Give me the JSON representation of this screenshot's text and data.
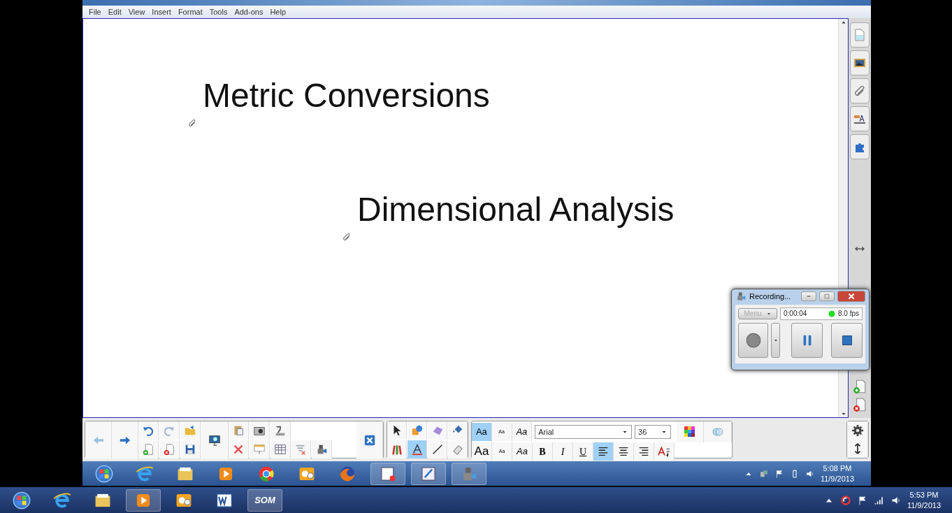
{
  "menu": [
    "File",
    "Edit",
    "View",
    "Insert",
    "Format",
    "Tools",
    "Add-ons",
    "Help"
  ],
  "page": {
    "titles": [
      "Metric Conversions",
      "Dimensional Analysis"
    ]
  },
  "recorder": {
    "title": "Recording...",
    "menu": {
      "label": "Menu",
      "disabled": true
    },
    "time": "0:00:04",
    "fps": "8.0 fps"
  },
  "tools": [
    {
      "kind": "select",
      "selected": false
    },
    {
      "kind": "shapes",
      "selected": false
    },
    {
      "kind": "eraser-shape",
      "selected": false
    },
    {
      "kind": "fill",
      "selected": false
    },
    {
      "kind": "pens",
      "selected": false
    },
    {
      "kind": "text",
      "selected": true
    },
    {
      "kind": "line",
      "selected": false
    },
    {
      "kind": "eraser",
      "selected": false
    }
  ],
  "text_styles": [
    {
      "label": "Aa",
      "kind": "normal",
      "selected": true
    },
    {
      "label": "Aa",
      "kind": "tiny",
      "selected": false
    },
    {
      "label": "Aa",
      "kind": "italic",
      "selected": false
    },
    {
      "label": "Aa",
      "kind": "large",
      "selected": false
    },
    {
      "label": "Aa",
      "kind": "tiny",
      "selected": false
    },
    {
      "label": "Aa",
      "kind": "italic",
      "selected": false
    }
  ],
  "font": "Arial",
  "font_size": "36",
  "format_buttons": [
    {
      "label": "B",
      "kind": "bold"
    },
    {
      "label": "I",
      "kind": "italic"
    },
    {
      "label": "U",
      "kind": "underline"
    }
  ],
  "align": [
    {
      "kind": "left",
      "selected": true
    },
    {
      "kind": "center",
      "selected": false
    },
    {
      "kind": "right",
      "selected": false
    }
  ],
  "inner_clock": {
    "time": "5:08 PM",
    "date": "11/9/2013"
  },
  "outer_taskbar": {
    "app_label": "SOM",
    "time": "5:53 PM",
    "date": "11/9/2013"
  }
}
